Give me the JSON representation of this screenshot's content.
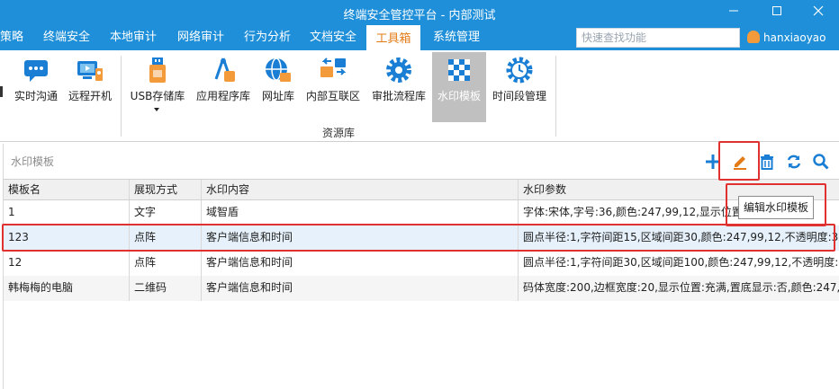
{
  "window": {
    "title": "终端安全管控平台 - 内部测试"
  },
  "menu": {
    "items": [
      "策略",
      "终端安全",
      "本地审计",
      "网络审计",
      "行为分析",
      "文档安全",
      "工具箱",
      "系统管理"
    ],
    "active_index": 6
  },
  "search": {
    "placeholder": "快速查找功能"
  },
  "user": {
    "name": "hanxiaoyao"
  },
  "ribbon": {
    "buttons": [
      "实时沟通",
      "远程开机",
      "USB存储库",
      "应用程序库",
      "网址库",
      "内部互联区",
      "审批流程库",
      "水印模板",
      "时间段管理"
    ],
    "selected": "水印模板",
    "group_label": "资源库"
  },
  "pane": {
    "title": "水印模板"
  },
  "tooltip": {
    "text": "编辑水印模板"
  },
  "table": {
    "headers": [
      "模板名",
      "展现方式",
      "水印内容",
      "水印参数"
    ],
    "rows": [
      [
        "1",
        "文字",
        "域智盾",
        "字体:宋体,字号:36,颜色:247,99,12,显示位置:充满"
      ],
      [
        "123",
        "点阵",
        "客户端信息和时间",
        "圆点半径:1,字符间距15,区域间距30,颜色:247,99,12,不透明度:3..."
      ],
      [
        "12",
        "点阵",
        "客户端信息和时间",
        "圆点半径:1,字符间距30,区域间距100,颜色:247,99,12,不透明度:..."
      ],
      [
        "韩梅梅的电脑",
        "二维码",
        "客户端信息和时间",
        "码体宽度:200,边框宽度:20,显示位置:充满,置底显示:否,颜色:247,..."
      ]
    ],
    "selected_row": 1
  },
  "colors": {
    "titlebar": "#1e8fd8",
    "accent": "#e37b17",
    "highlight": "#e03030",
    "icon_blue": "#1a7fd4"
  }
}
